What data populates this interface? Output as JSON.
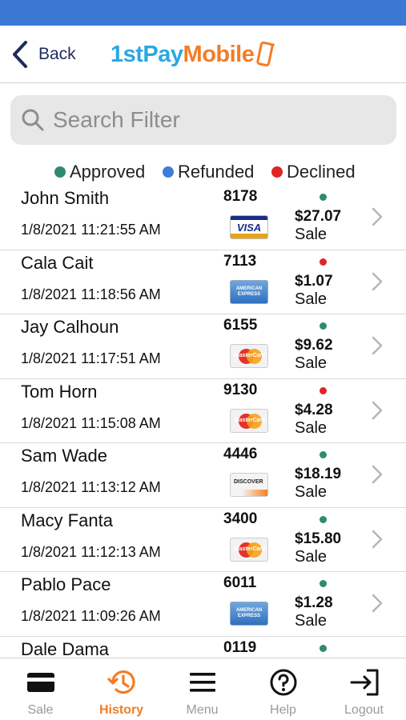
{
  "header": {
    "back_label": "Back",
    "logo_part1": "1st",
    "logo_part2": "Pay",
    "logo_part3": "Mobile"
  },
  "search": {
    "placeholder": "Search Filter",
    "value": ""
  },
  "legend": [
    {
      "label": "Approved",
      "color": "#2f8a72"
    },
    {
      "label": "Refunded",
      "color": "#3a7fd9"
    },
    {
      "label": "Declined",
      "color": "#e02424"
    }
  ],
  "transactions": [
    {
      "name": "John Smith",
      "datetime": "1/8/2021 11:21:55 AM",
      "last4": "8178",
      "card": "visa",
      "card_text": "VISA",
      "status": "approved",
      "amount": "$27.07",
      "type": "Sale"
    },
    {
      "name": "Cala Cait",
      "datetime": "1/8/2021 11:18:56 AM",
      "last4": "7113",
      "card": "amex",
      "card_text": "AMERICAN EXPRESS",
      "status": "declined",
      "amount": "$1.07",
      "type": "Sale"
    },
    {
      "name": "Jay Calhoun",
      "datetime": "1/8/2021 11:17:51 AM",
      "last4": "6155",
      "card": "mastercard",
      "card_text": "MasterCard",
      "status": "approved",
      "amount": "$9.62",
      "type": "Sale"
    },
    {
      "name": "Tom Horn",
      "datetime": "1/8/2021 11:15:08 AM",
      "last4": "9130",
      "card": "mastercard",
      "card_text": "MasterCard",
      "status": "declined",
      "amount": "$4.28",
      "type": "Sale"
    },
    {
      "name": "Sam Wade",
      "datetime": "1/8/2021 11:13:12 AM",
      "last4": "4446",
      "card": "discover",
      "card_text": "DISCOVER",
      "status": "approved",
      "amount": "$18.19",
      "type": "Sale"
    },
    {
      "name": "Macy Fanta",
      "datetime": "1/8/2021 11:12:13 AM",
      "last4": "3400",
      "card": "mastercard",
      "card_text": "MasterCard",
      "status": "approved",
      "amount": "$15.80",
      "type": "Sale"
    },
    {
      "name": "Pablo Pace",
      "datetime": "1/8/2021 11:09:26 AM",
      "last4": "6011",
      "card": "amex",
      "card_text": "AMERICAN EXPRESS",
      "status": "approved",
      "amount": "$1.28",
      "type": "Sale"
    },
    {
      "name": "Dale Dama",
      "datetime": "",
      "last4": "0119",
      "card": "",
      "card_text": "",
      "status": "approved",
      "amount": "",
      "type": ""
    }
  ],
  "status_colors": {
    "approved": "#2f8a72",
    "refunded": "#3a7fd9",
    "declined": "#e02424"
  },
  "tabs": [
    {
      "label": "Sale",
      "icon": "credit-card-icon",
      "active": false
    },
    {
      "label": "History",
      "icon": "history-icon",
      "active": true
    },
    {
      "label": "Menu",
      "icon": "menu-icon",
      "active": false
    },
    {
      "label": "Help",
      "icon": "help-icon",
      "active": false
    },
    {
      "label": "Logout",
      "icon": "logout-icon",
      "active": false
    }
  ],
  "colors": {
    "status_bar": "#3a78d4",
    "accent": "#f47c25",
    "brand_blue": "#2aa8e0",
    "back_navy": "#1e2a5e",
    "inactive_tab": "#9a9a9a"
  }
}
